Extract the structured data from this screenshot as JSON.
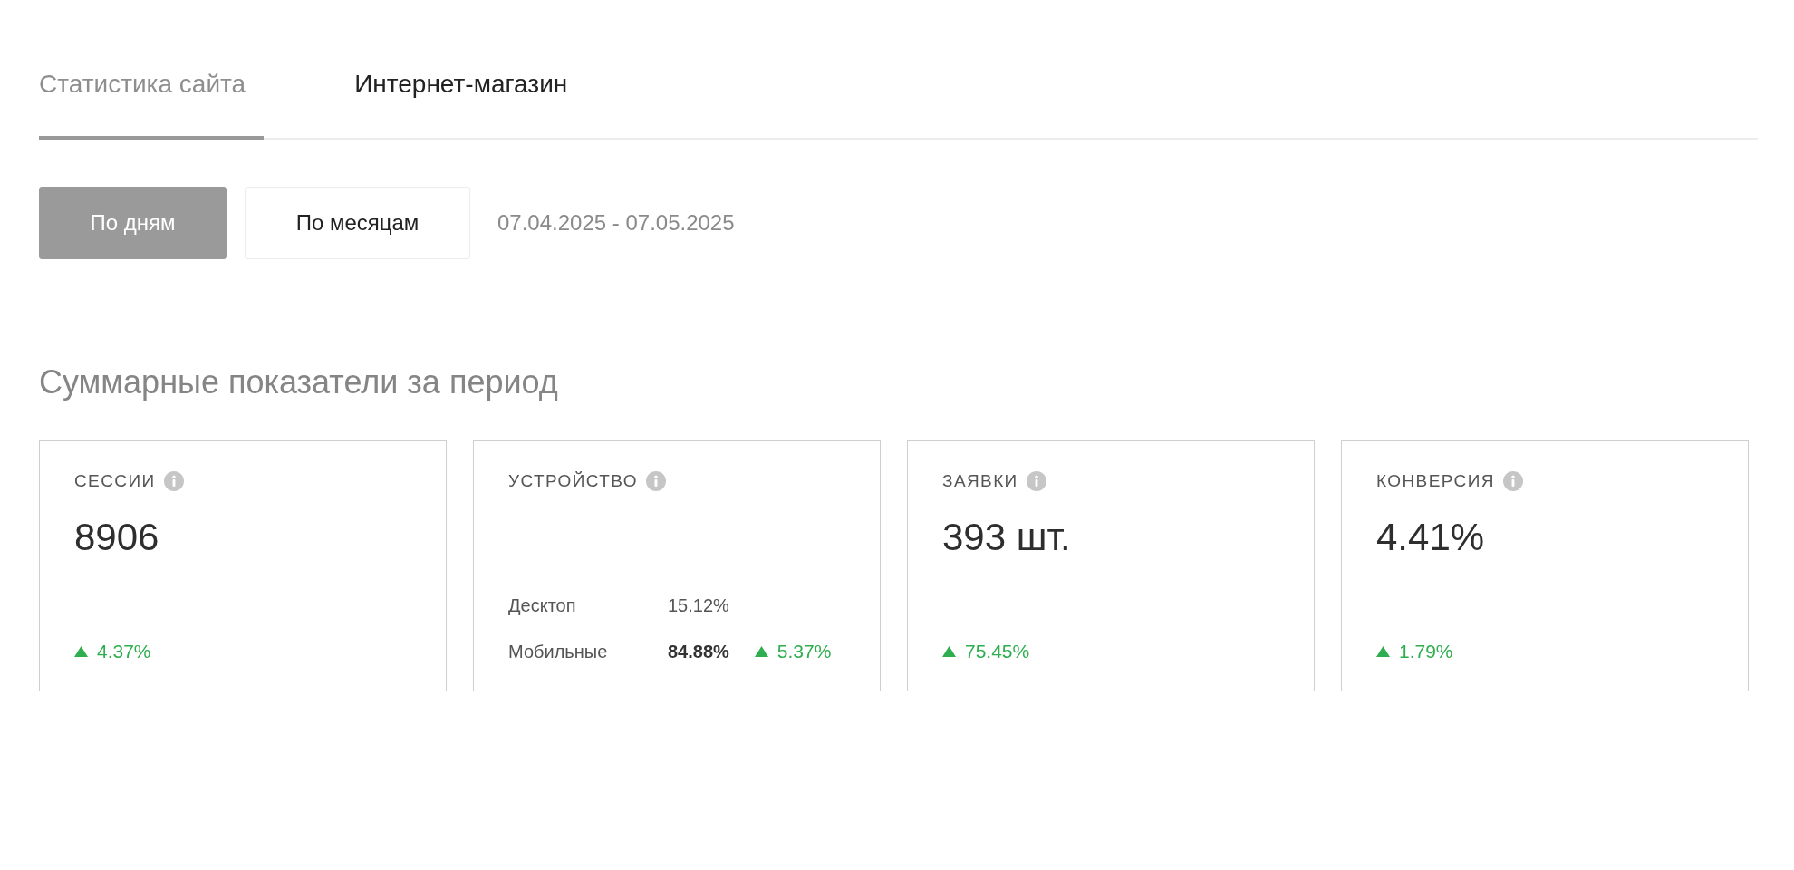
{
  "tabs": [
    {
      "label": "Статистика сайта",
      "selected": true
    },
    {
      "label": "Интернет-магазин",
      "selected": false
    }
  ],
  "period_buttons": [
    {
      "label": "По дням",
      "selected": true
    },
    {
      "label": "По месяцам",
      "selected": false
    }
  ],
  "date_range": "07.04.2025 - 07.05.2025",
  "summary": {
    "title": "Суммарные показатели за период",
    "cards": [
      {
        "kind": "value",
        "label": "СЕССИИ",
        "value": "8906",
        "trend": "4.37%"
      },
      {
        "kind": "devices",
        "label": "УСТРОЙСТВО",
        "rows": [
          {
            "name": "Десктоп",
            "share": "15.12%",
            "emphasized": false
          },
          {
            "name": "Мобильные",
            "share": "84.88%",
            "emphasized": true,
            "trend": "5.37%"
          }
        ]
      },
      {
        "kind": "value",
        "label": "ЗАЯВКИ",
        "value": "393 шт.",
        "trend": "75.45%"
      },
      {
        "kind": "value",
        "label": "КОНВЕРСИЯ",
        "value": "4.41%",
        "trend": "1.79%"
      }
    ]
  }
}
